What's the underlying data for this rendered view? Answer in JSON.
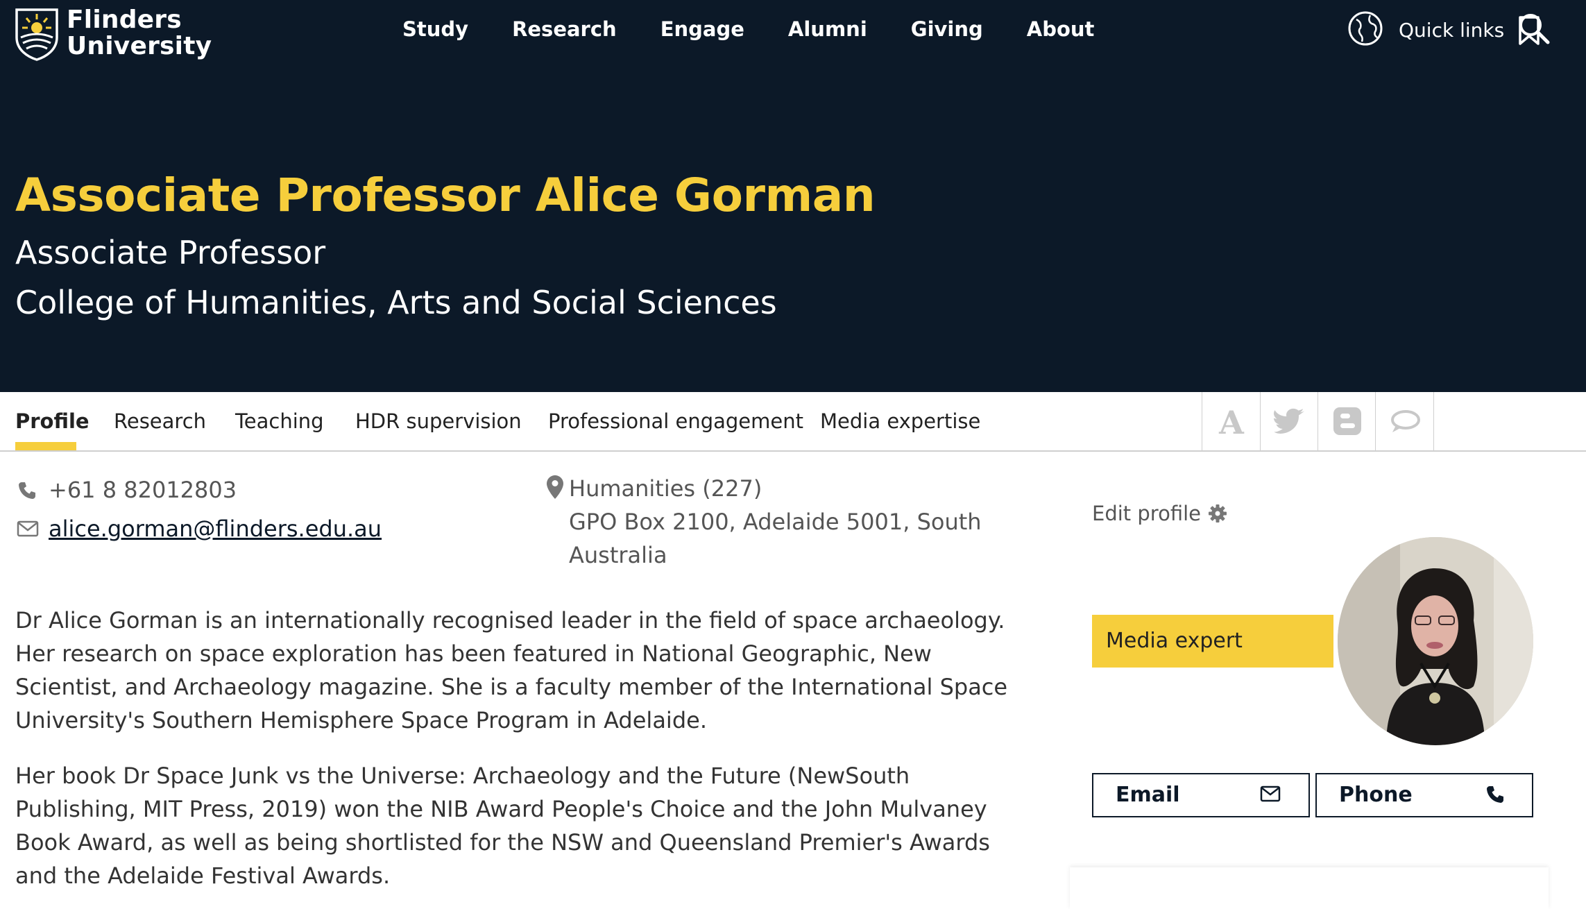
{
  "brand": {
    "line1": "Flinders",
    "line2": "University"
  },
  "nav": [
    "Study",
    "Research",
    "Engage",
    "Alumni",
    "Giving",
    "About"
  ],
  "tools": {
    "quick_links": "Quick links"
  },
  "profile": {
    "name": "Associate Professor Alice Gorman",
    "title": "Associate Professor",
    "college": "College of Humanities, Arts and Social Sciences"
  },
  "tabs": [
    "Profile",
    "Research",
    "Teaching",
    "HDR supervision",
    "Professional engagement",
    "Media expertise"
  ],
  "active_tab": "Profile",
  "contact": {
    "phone": "+61 8 82012803",
    "email": "alice.gorman@flinders.edu.au",
    "location_line1": "Humanities (227)",
    "location_line2": "GPO Box 2100, Adelaide 5001, South Australia"
  },
  "bio": [
    "Dr Alice Gorman is an internationally recognised leader in the field of space archaeology. Her research on space exploration has been featured in National Geographic, New Scientist, and Archaeology magazine. She is a faculty member of the International Space University's Southern Hemisphere Space Program in Adelaide.",
    "Her book Dr Space Junk vs the Universe: Archaeology and the Future (NewSouth Publishing, MIT Press, 2019) won the NIB Award People's Choice and the John Mulvaney Book Award, as well as being shortlisted for the NSW and Queensland Premier's Awards and the Adelaide Festival Awards."
  ],
  "sidebar": {
    "edit_profile": "Edit profile",
    "media_expert": "Media expert",
    "email_button": "Email",
    "phone_button": "Phone"
  },
  "colors": {
    "navy": "#0c1928",
    "gold": "#f6ce3c"
  }
}
